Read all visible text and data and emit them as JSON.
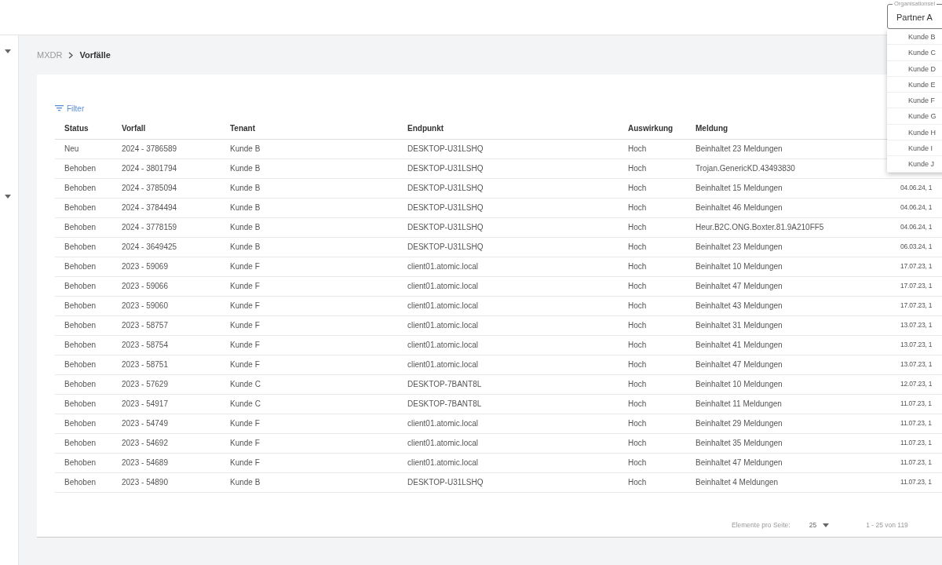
{
  "sidebar": {
    "groups": [
      {
        "expanded": true
      },
      {
        "expanded": true
      }
    ]
  },
  "breadcrumb": [
    {
      "label": "MXDR",
      "current": false
    },
    {
      "label": "Vorfälle",
      "current": true
    }
  ],
  "filter": {
    "label": "Filter"
  },
  "table": {
    "columns": [
      "Status",
      "Vorfall",
      "Tenant",
      "Endpunkt",
      "Auswirkung",
      "Meldung"
    ],
    "rows": [
      {
        "status": "Neu",
        "incident": "2024 - 3786589",
        "tenant": "Kunde B",
        "endpoint": "DESKTOP-U31LSHQ",
        "impact": "Hoch",
        "message": "Beinhaltet 23 Meldungen"
      },
      {
        "status": "Behoben",
        "incident": "2024 - 3801794",
        "tenant": "Kunde B",
        "endpoint": "DESKTOP-U31LSHQ",
        "impact": "Hoch",
        "message": "Trojan.GenericKD.43493830"
      },
      {
        "status": "Behoben",
        "incident": "2024 - 3785094",
        "tenant": "Kunde B",
        "endpoint": "DESKTOP-U31LSHQ",
        "impact": "Hoch",
        "message": "Beinhaltet 15 Meldungen",
        "date": "04.06.24, 1"
      },
      {
        "status": "Behoben",
        "incident": "2024 - 3784494",
        "tenant": "Kunde B",
        "endpoint": "DESKTOP-U31LSHQ",
        "impact": "Hoch",
        "message": "Beinhaltet 46 Meldungen",
        "date": "04.06.24, 1"
      },
      {
        "status": "Behoben",
        "incident": "2024 - 3778159",
        "tenant": "Kunde B",
        "endpoint": "DESKTOP-U31LSHQ",
        "impact": "Hoch",
        "message": "Heur.B2C.ONG.Boxter.81.9A210FF5",
        "date": "04.06.24, 1"
      },
      {
        "status": "Behoben",
        "incident": "2024 - 3649425",
        "tenant": "Kunde B",
        "endpoint": "DESKTOP-U31LSHQ",
        "impact": "Hoch",
        "message": "Beinhaltet 23 Meldungen",
        "date": "06.03.24, 1"
      },
      {
        "status": "Behoben",
        "incident": "2023 - 59069",
        "tenant": "Kunde F",
        "endpoint": "client01.atomic.local",
        "impact": "Hoch",
        "message": "Beinhaltet 10 Meldungen",
        "date": "17.07.23, 1"
      },
      {
        "status": "Behoben",
        "incident": "2023 - 59066",
        "tenant": "Kunde F",
        "endpoint": "client01.atomic.local",
        "impact": "Hoch",
        "message": "Beinhaltet 47 Meldungen",
        "date": "17.07.23, 1"
      },
      {
        "status": "Behoben",
        "incident": "2023 - 59060",
        "tenant": "Kunde F",
        "endpoint": "client01.atomic.local",
        "impact": "Hoch",
        "message": "Beinhaltet 43 Meldungen",
        "date": "17.07.23, 1"
      },
      {
        "status": "Behoben",
        "incident": "2023 - 58757",
        "tenant": "Kunde F",
        "endpoint": "client01.atomic.local",
        "impact": "Hoch",
        "message": "Beinhaltet 31 Meldungen",
        "date": "13.07.23, 1"
      },
      {
        "status": "Behoben",
        "incident": "2023 - 58754",
        "tenant": "Kunde F",
        "endpoint": "client01.atomic.local",
        "impact": "Hoch",
        "message": "Beinhaltet 41 Meldungen",
        "date": "13.07.23, 1"
      },
      {
        "status": "Behoben",
        "incident": "2023 - 58751",
        "tenant": "Kunde F",
        "endpoint": "client01.atomic.local",
        "impact": "Hoch",
        "message": "Beinhaltet 47 Meldungen",
        "date": "13.07.23, 1"
      },
      {
        "status": "Behoben",
        "incident": "2023 - 57629",
        "tenant": "Kunde C",
        "endpoint": "DESKTOP-7BANT8L",
        "impact": "Hoch",
        "message": "Beinhaltet 10 Meldungen",
        "date": "12.07.23, 1"
      },
      {
        "status": "Behoben",
        "incident": "2023 - 54917",
        "tenant": "Kunde C",
        "endpoint": "DESKTOP-7BANT8L",
        "impact": "Hoch",
        "message": "Beinhaltet 11 Meldungen",
        "date": "11.07.23, 1"
      },
      {
        "status": "Behoben",
        "incident": "2023 - 54749",
        "tenant": "Kunde F",
        "endpoint": "client01.atomic.local",
        "impact": "Hoch",
        "message": "Beinhaltet 29 Meldungen",
        "date": "11.07.23, 1"
      },
      {
        "status": "Behoben",
        "incident": "2023 - 54692",
        "tenant": "Kunde F",
        "endpoint": "client01.atomic.local",
        "impact": "Hoch",
        "message": "Beinhaltet 35 Meldungen",
        "date": "11.07.23, 1"
      },
      {
        "status": "Behoben",
        "incident": "2023 - 54689",
        "tenant": "Kunde F",
        "endpoint": "client01.atomic.local",
        "impact": "Hoch",
        "message": "Beinhaltet 47 Meldungen",
        "date": "11.07.23, 1"
      },
      {
        "status": "Behoben",
        "incident": "2023 - 54890",
        "tenant": "Kunde B",
        "endpoint": "DESKTOP-U31LSHQ",
        "impact": "Hoch",
        "message": "Beinhaltet 4 Meldungen",
        "date": "11.07.23, 1"
      }
    ]
  },
  "pagination": {
    "per_page_label": "Elemente pro Seite:",
    "per_page": "25",
    "range": "1 - 25 von 119"
  },
  "org_select": {
    "label": "Organisationsei",
    "value": "Partner A",
    "expanded": true,
    "options": [
      "Kunde B",
      "Kunde C",
      "Kunde D",
      "Kunde E",
      "Kunde F",
      "Kunde G",
      "Kunde H",
      "Kunde I",
      "Kunde J"
    ]
  }
}
